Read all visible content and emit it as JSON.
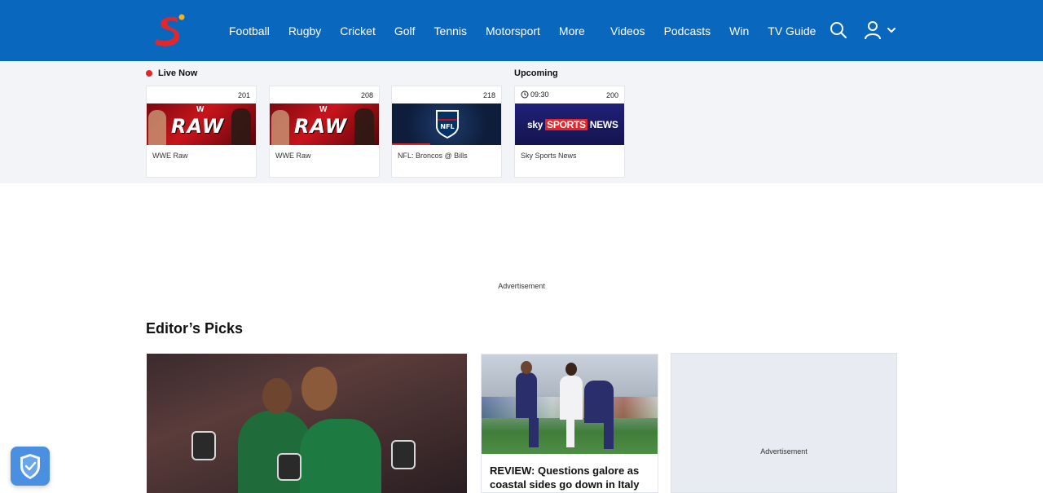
{
  "header": {
    "logo_icon": "supersport-s-logo",
    "nav_left": [
      {
        "label": "Football"
      },
      {
        "label": "Rugby"
      },
      {
        "label": "Cricket"
      },
      {
        "label": "Golf"
      },
      {
        "label": "Tennis"
      },
      {
        "label": "Motorsport"
      },
      {
        "label": "More"
      }
    ],
    "nav_right": [
      {
        "label": "Videos"
      },
      {
        "label": "Podcasts"
      },
      {
        "label": "Win"
      },
      {
        "label": "TV Guide"
      }
    ],
    "icons": [
      "search-icon",
      "user-icon",
      "chevron-down-icon"
    ],
    "brand_color": "#0a67be"
  },
  "strip": {
    "live_label": "Live Now",
    "upcoming_label": "Upcoming",
    "live_dot_color": "#e4262a",
    "cards": [
      {
        "channel": "201",
        "title": "WWE Raw",
        "image": "WWE Raw banner",
        "image_text": "RAW"
      },
      {
        "channel": "208",
        "title": "WWE Raw",
        "image": "WWE Raw banner",
        "image_text": "RAW"
      },
      {
        "channel": "218",
        "title": "NFL: Broncos @ Bills",
        "image": "NFL shield logo",
        "progress": 0.35
      },
      {
        "channel": "200",
        "time": "09:30",
        "title": "Sky Sports News",
        "image": "Sky Sports News logo",
        "image_text": "sky SPORTS NEWS"
      }
    ]
  },
  "ad": {
    "label": "Advertisement"
  },
  "editors_picks": {
    "title": "Editor’s Picks",
    "feature": {
      "image": "Cricket players celebrating"
    },
    "story": {
      "image": "Rugby match tackle",
      "title": "REVIEW: Questions galore as coastal sides go down in Italy"
    },
    "ad_label": "Advertisement"
  },
  "privacy_button": {
    "icon": "shield-check-icon"
  }
}
